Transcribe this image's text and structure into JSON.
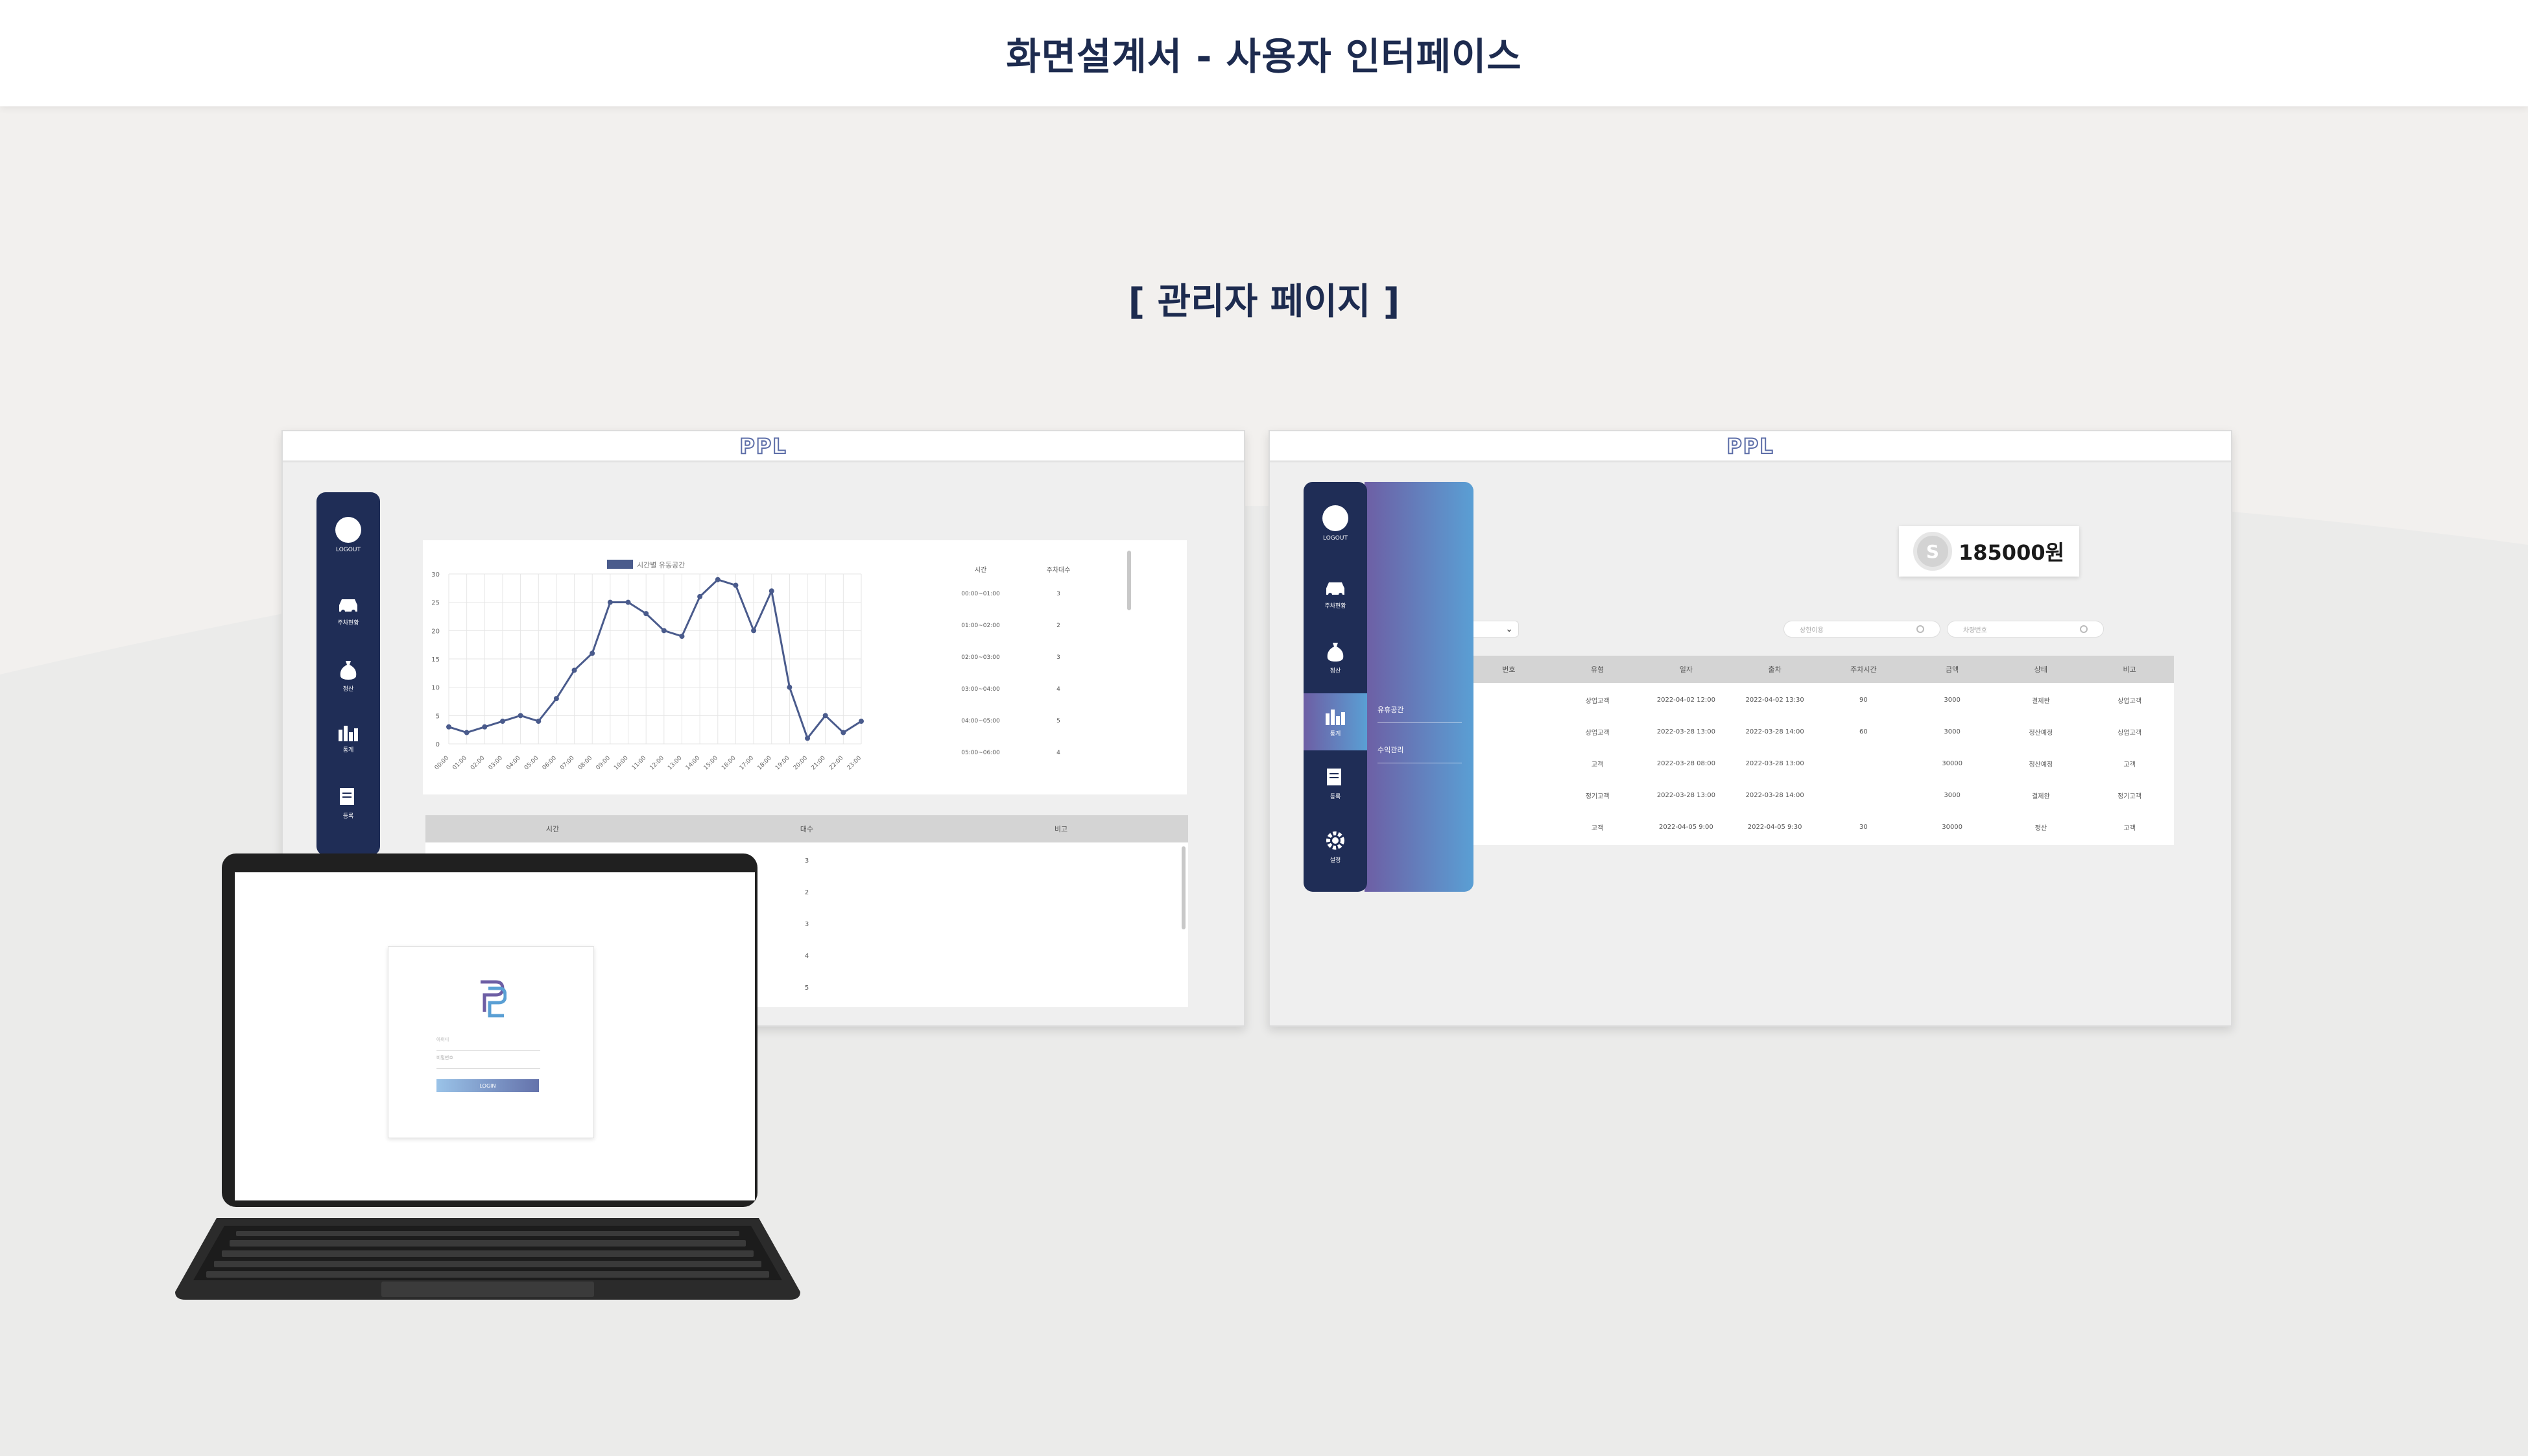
{
  "header": {
    "title": "화면설계서 - 사용자 인터페이스"
  },
  "section": {
    "title": "[ 관리자 페이지 ]"
  },
  "brand": {
    "logo": "PPL",
    "accent": "#1f2d56",
    "line_color": "#4a5b8c"
  },
  "sidebar": {
    "logout": "LOGOUT",
    "items": [
      "주차현황",
      "정산",
      "통계",
      "등록",
      "설정"
    ]
  },
  "left_panel": {
    "legend": "시간별 유동공간",
    "y_ticks": [
      "30",
      "25",
      "20",
      "15",
      "10",
      "5",
      "0"
    ],
    "right_table": {
      "headers": [
        "시간",
        "주차대수"
      ],
      "rows": [
        [
          "00:00~01:00",
          "3"
        ],
        [
          "01:00~02:00",
          "2"
        ],
        [
          "02:00~03:00",
          "3"
        ],
        [
          "03:00~04:00",
          "4"
        ],
        [
          "04:00~05:00",
          "5"
        ],
        [
          "05:00~06:00",
          "4"
        ]
      ]
    },
    "bottom_table": {
      "headers": [
        "시간",
        "대수",
        "비고"
      ],
      "counts": [
        "3",
        "2",
        "3",
        "4",
        "5"
      ]
    }
  },
  "chart_data": {
    "type": "line",
    "title": "",
    "legend": [
      "시간별 유동공간"
    ],
    "x": [
      "00:00",
      "01:00",
      "02:00",
      "03:00",
      "04:00",
      "05:00",
      "06:00",
      "07:00",
      "08:00",
      "09:00",
      "10:00",
      "11:00",
      "12:00",
      "13:00",
      "14:00",
      "15:00",
      "16:00",
      "17:00",
      "18:00",
      "19:00",
      "20:00",
      "21:00",
      "22:00",
      "23:00"
    ],
    "series": [
      {
        "name": "시간별 유동공간",
        "values": [
          3,
          2,
          3,
          4,
          5,
          4,
          8,
          13,
          16,
          25,
          25,
          23,
          20,
          19,
          26,
          29,
          28,
          20,
          27,
          10,
          1,
          5,
          2,
          4
        ]
      }
    ],
    "ylim": [
      0,
      30
    ],
    "grid": true
  },
  "right_panel": {
    "balance": "185000원",
    "submenu": [
      "유휴공간",
      "수익관리"
    ],
    "search_placeholders": [
      "상한이용",
      "차량번호"
    ],
    "table": {
      "headers": [
        "번호",
        "유형",
        "일자",
        "출차",
        "주차시간",
        "금액",
        "상태",
        "비고"
      ],
      "rows": [
        [
          "",
          "상업고객",
          "2022-04-02 12:00",
          "2022-04-02 13:30",
          "90",
          "3000",
          "결제완",
          "상업고객"
        ],
        [
          "",
          "상업고객",
          "2022-03-28 13:00",
          "2022-03-28 14:00",
          "60",
          "3000",
          "정산예정",
          "상업고객"
        ],
        [
          "",
          "고객",
          "2022-03-28 08:00",
          "2022-03-28 13:00",
          "",
          "30000",
          "정산예정",
          "고객"
        ],
        [
          "",
          "정기고객",
          "2022-03-28 13:00",
          "2022-03-28 14:00",
          "",
          "3000",
          "결제완",
          "정기고객"
        ],
        [
          "",
          "고객",
          "2022-04-05 9:00",
          "2022-04-05 9:30",
          "30",
          "30000",
          "정산",
          "고객"
        ]
      ]
    }
  },
  "login": {
    "logo": "PPL",
    "id_placeholder": "아이디",
    "pw_placeholder": "비밀번호",
    "button": "LOGIN"
  }
}
